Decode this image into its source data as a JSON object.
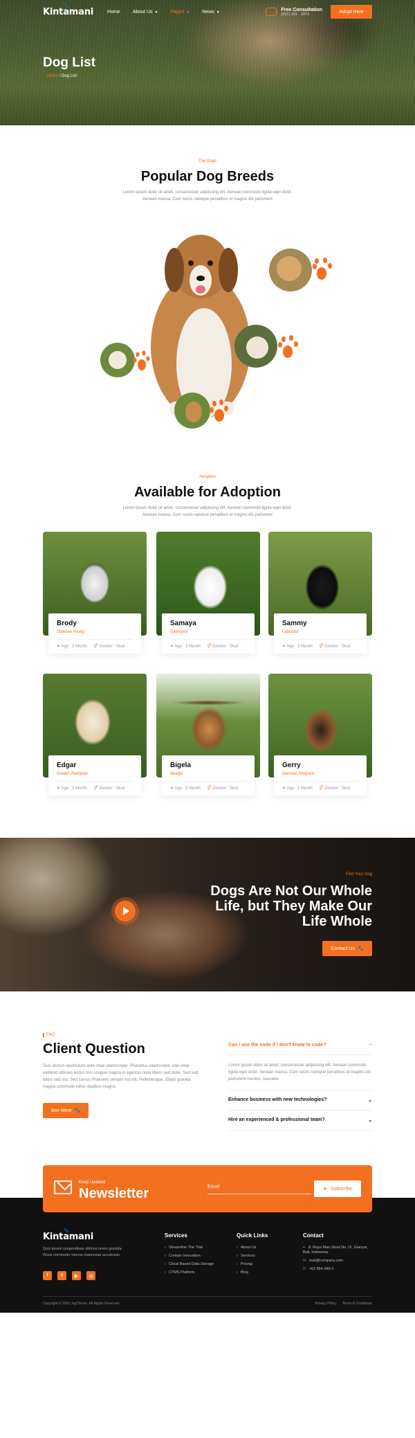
{
  "brand": "Kintamani",
  "nav": {
    "items": [
      "Home",
      "About Us",
      "Pages",
      "News"
    ],
    "consult_title": "Free Consultation",
    "consult_phone": "(021) 331 - 2870",
    "cta": "Adopt Here"
  },
  "hero": {
    "title": "Dog List",
    "crumb_home": "Home",
    "crumb_sep": "/",
    "crumb_current": "Dog List"
  },
  "breeds": {
    "kicker": "The Dogs",
    "title": "Popular Dog Breeds",
    "desc": "Lorem ipsum dolor sit amet, consectetuer adipiscing elit. Aenean commodo ligula eget dolor. Aenean massa. Cum sociis natoque penatibus et magnis dis parturient"
  },
  "adoption": {
    "kicker": "Adoption",
    "title": "Available for Adoption",
    "desc": "Lorem ipsum dolor sit amet, consectetuer adipiscing elit. Aenean commodo ligula eget dolor. Aenean massa. Cum sociis natoque penatibus et magnis dis parturient",
    "cards": [
      {
        "name": "Brody",
        "breed": "Siberian Husky",
        "age": "Age : 3 Month",
        "gender": "Gender : Stud"
      },
      {
        "name": "Samaya",
        "breed": "Samoyed",
        "age": "Age : 3 Month",
        "gender": "Gender : Stud"
      },
      {
        "name": "Sammy",
        "breed": "Labrador",
        "age": "Age : 3 Month",
        "gender": "Gender : Stud"
      },
      {
        "name": "Edgar",
        "breed": "Golden Retriever",
        "age": "Age : 3 Month",
        "gender": "Gender : Stud"
      },
      {
        "name": "Bigela",
        "breed": "Beagle",
        "age": "Age : 3 Month",
        "gender": "Gender : Stud"
      },
      {
        "name": "Gerry",
        "breed": "German Shepard",
        "age": "Age : 3 Month",
        "gender": "Gender : Stud"
      }
    ]
  },
  "banner": {
    "kicker": "Find Your Dog",
    "title": "Dogs Are Not Our Whole Life, but They Make Our Life Whole",
    "cta": "Contact Us"
  },
  "faq": {
    "kicker": "FAQ",
    "title": "Client Question",
    "desc": "Duis dictum vestibulum ante vitae ullamcorper. Phasellus ullamcorper odio vitae eleifend ultricies lectus orci congue magna in egestas nulla libero sed dolor. Sed sed tellus sed nisl. Sed cursus Praesent semper est elit. Pellentesque. Etiam gravida magna commodo tellus dapibus magna.",
    "cta": "See More",
    "questions": [
      {
        "q": "Can i use the code if i don't know to code?",
        "a": "Lorem ipsum dolor sit amet, consectetuer adipiscing elit. Aenean commodo ligula eget dolor. Aenean massa. Cum sociis natoque penatibus et magnis dis parturient montes, nascetur."
      },
      {
        "q": "Enhance business with new technologies?"
      },
      {
        "q": "Hire an experienced & professional team?"
      }
    ]
  },
  "newsletter": {
    "kicker": "Keep Updated",
    "title": "Newsletter",
    "email_placeholder": "Email",
    "cta": "Subscribe"
  },
  "footer": {
    "desc": "Quis ipsum suspendisse ultrices lorem gravida. Risus commodo viverra maecenas accumsan.",
    "services_title": "Services",
    "services": [
      "Streamline The Trial",
      "Contain Innovation",
      "Cloud Based Data Storage",
      "CTMS Platform"
    ],
    "links_title": "Quick Links",
    "links": [
      "About Us",
      "Services",
      "Pricing",
      "Blog"
    ],
    "contact_title": "Contact",
    "contact": [
      "Jl. Raya Mas Ubud No. IX, Gianyar, Bali, Indonesia.",
      "mail@company.com",
      "+62 864-349-1"
    ],
    "copyright": "Copyright © 2020 JogTheme. All Rights Reserved.",
    "privacy": "Privacy Policy",
    "terms": "Terms & Conditions"
  }
}
